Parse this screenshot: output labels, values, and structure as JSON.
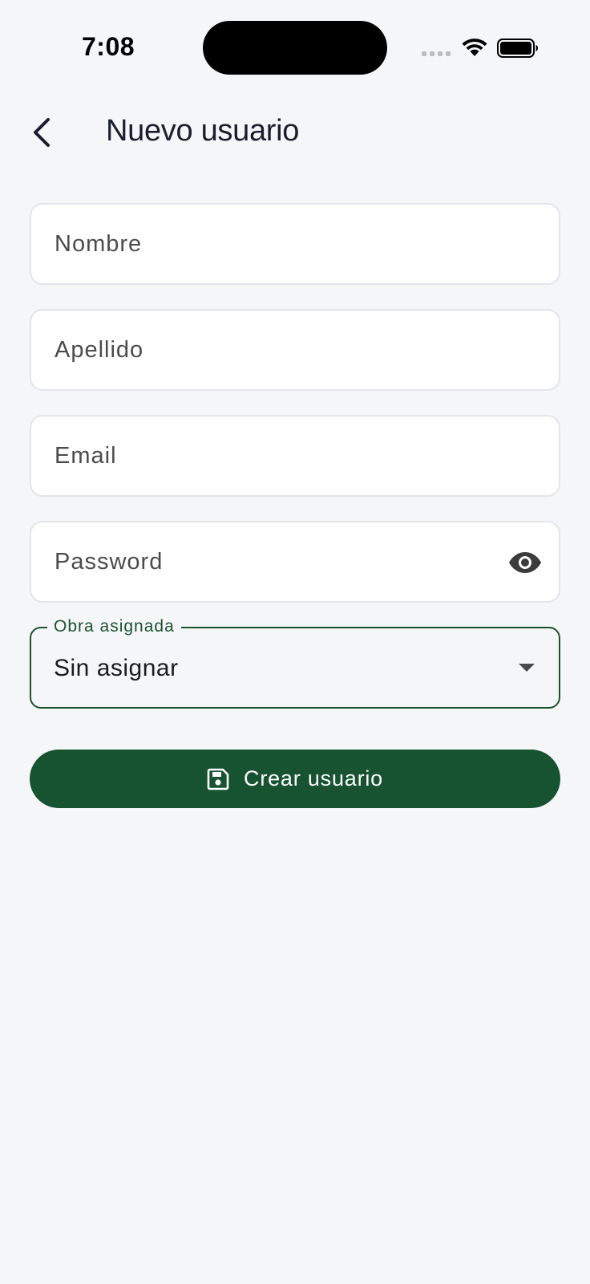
{
  "status_bar": {
    "time": "7:08"
  },
  "header": {
    "title": "Nuevo usuario",
    "back_icon": "chevron-left-icon"
  },
  "form": {
    "nombre_placeholder": "Nombre",
    "apellido_placeholder": "Apellido",
    "email_placeholder": "Email",
    "password_placeholder": "Password",
    "password_toggle_icon": "eye-icon",
    "obra": {
      "label": "Obra asignada",
      "value": "Sin asignar"
    },
    "submit_label": "Crear usuario",
    "submit_icon": "save-icon"
  },
  "colors": {
    "primary": "#175331",
    "background": "#f5f6f8",
    "title": "#1b1e2e"
  }
}
